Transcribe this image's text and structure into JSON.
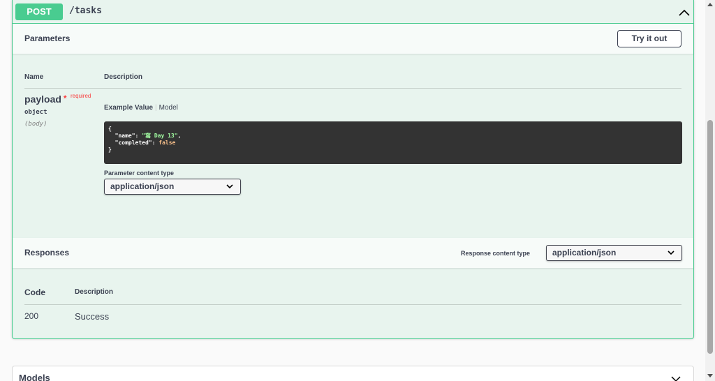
{
  "operation": {
    "method": "POST",
    "path": "/tasks"
  },
  "parameters": {
    "title": "Parameters",
    "try_button": "Try it out",
    "col_name": "Name",
    "col_description": "Description",
    "param": {
      "name": "payload",
      "star": "*",
      "required": "required",
      "type": "object",
      "in": "(body)"
    },
    "tabs": {
      "example": "Example Value",
      "separator": "|",
      "model": "Model"
    },
    "example_json": {
      "open": "{",
      "name_key": "\"name\"",
      "name_value": "\"寫 Day 13\"",
      "completed_key": "\"completed\"",
      "completed_value": "false",
      "close": "}"
    },
    "content_type_label": "Parameter content type",
    "content_type_value": "application/json"
  },
  "responses": {
    "title": "Responses",
    "content_type_label": "Response content type",
    "content_type_value": "application/json",
    "col_code": "Code",
    "col_description": "Description",
    "rows": [
      {
        "code": "200",
        "description": "Success"
      }
    ]
  },
  "models": {
    "title": "Models"
  },
  "colors": {
    "post_green": "#49cc90",
    "block_bg": "#e8f4ee",
    "required_red": "#f93e3e",
    "code_bg": "#333333"
  }
}
